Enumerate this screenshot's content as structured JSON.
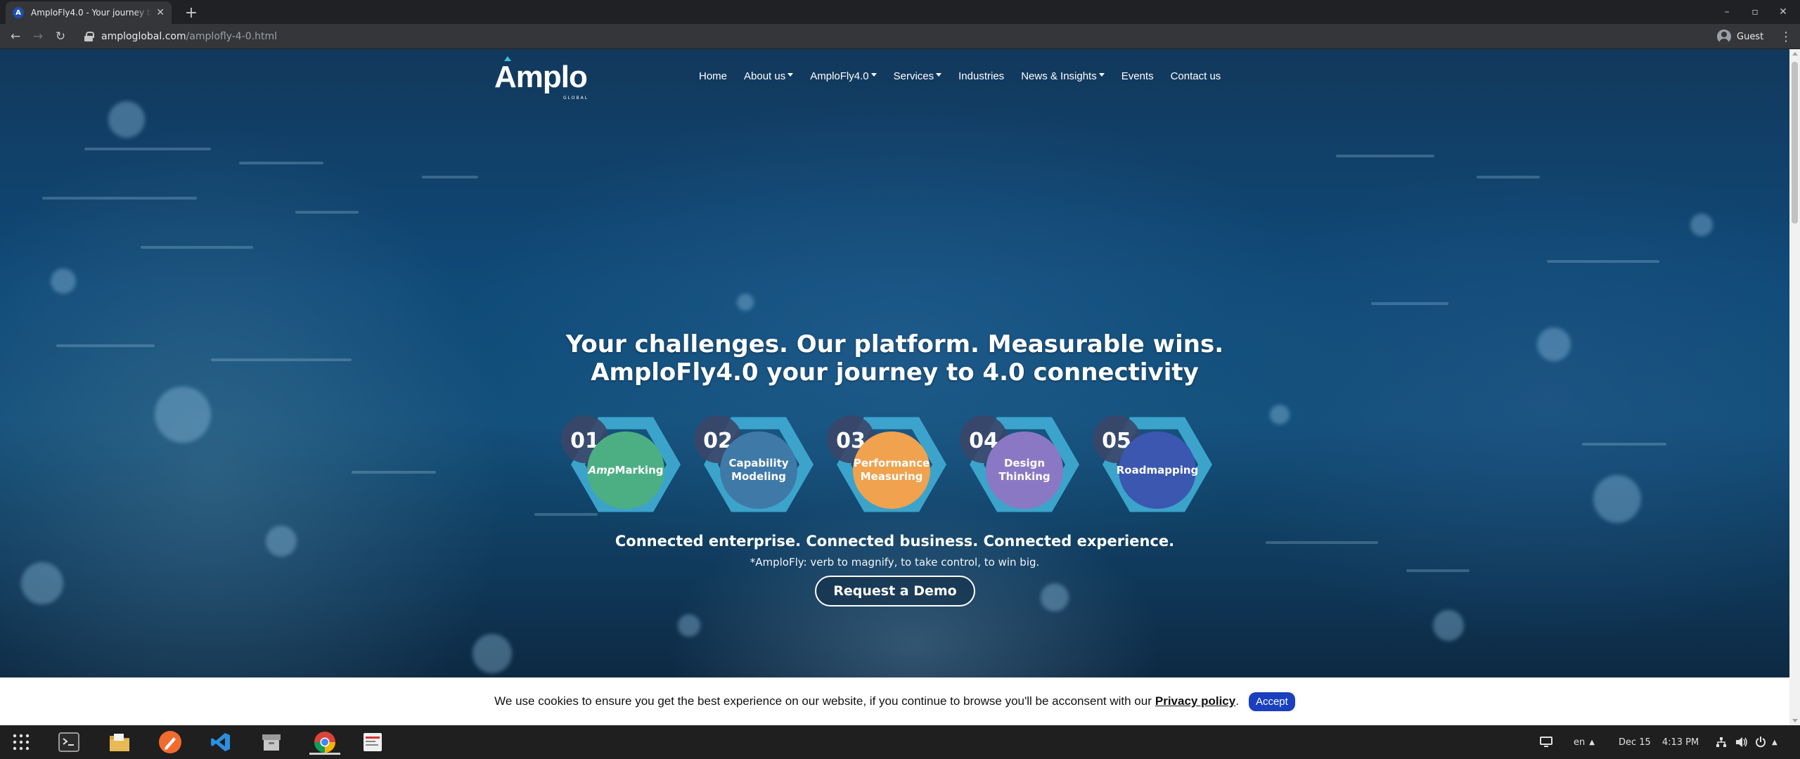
{
  "browser": {
    "tab_title": "AmploFly4.0 - Your journey to",
    "tab_favicon": "A",
    "new_tab": "+",
    "url_host": "amploglobal.com",
    "url_path": "/amplofly-4-0.html",
    "profile_name": "Guest"
  },
  "site": {
    "logo": "Amplo",
    "logo_sub": "GLOBAL",
    "nav": [
      {
        "label": "Home",
        "dropdown": false
      },
      {
        "label": "About us",
        "dropdown": true
      },
      {
        "label": "AmploFly4.0",
        "dropdown": true
      },
      {
        "label": "Services",
        "dropdown": true
      },
      {
        "label": "Industries",
        "dropdown": false
      },
      {
        "label": "News & Insights",
        "dropdown": true
      },
      {
        "label": "Events",
        "dropdown": false
      },
      {
        "label": "Contact us",
        "dropdown": false
      }
    ]
  },
  "hero": {
    "title_line1": "Your challenges. Our platform. Measurable wins.",
    "title_line2": "AmploFly4.0 your journey to 4.0 connectivity",
    "steps": [
      {
        "number": "01",
        "label_italic": "Amp",
        "label": "Marking",
        "color": "#4caf84"
      },
      {
        "number": "02",
        "label_line1": "Capability",
        "label_line2": "Modeling",
        "color": "#3f79a8"
      },
      {
        "number": "03",
        "label_line1": "Performance",
        "label_line2": "Measuring",
        "color": "#f0a24e"
      },
      {
        "number": "04",
        "label_line1": "Design",
        "label_line2": "Thinking",
        "color": "#8a78c4"
      },
      {
        "number": "05",
        "label": "Roadmapping",
        "color": "#3b57b0"
      }
    ],
    "tagline": "Connected enterprise. Connected business. Connected experience.",
    "definition": "*AmploFly: verb to magnify, to take control, to win big.",
    "demo_button": "Request a Demo"
  },
  "cookie": {
    "text": "We use cookies to ensure you get the best experience on our website, if you continue to browse you'll be acconsent with our",
    "link": "Privacy policy",
    "period": ".",
    "accept": "Accept"
  },
  "taskbar": {
    "language": "en",
    "date": "Dec 15",
    "time": "4:13 PM"
  },
  "colors": {
    "hexagon": "#3ea9d0",
    "number_circle": "#3a4668",
    "accept_button": "#1a3fbf"
  }
}
